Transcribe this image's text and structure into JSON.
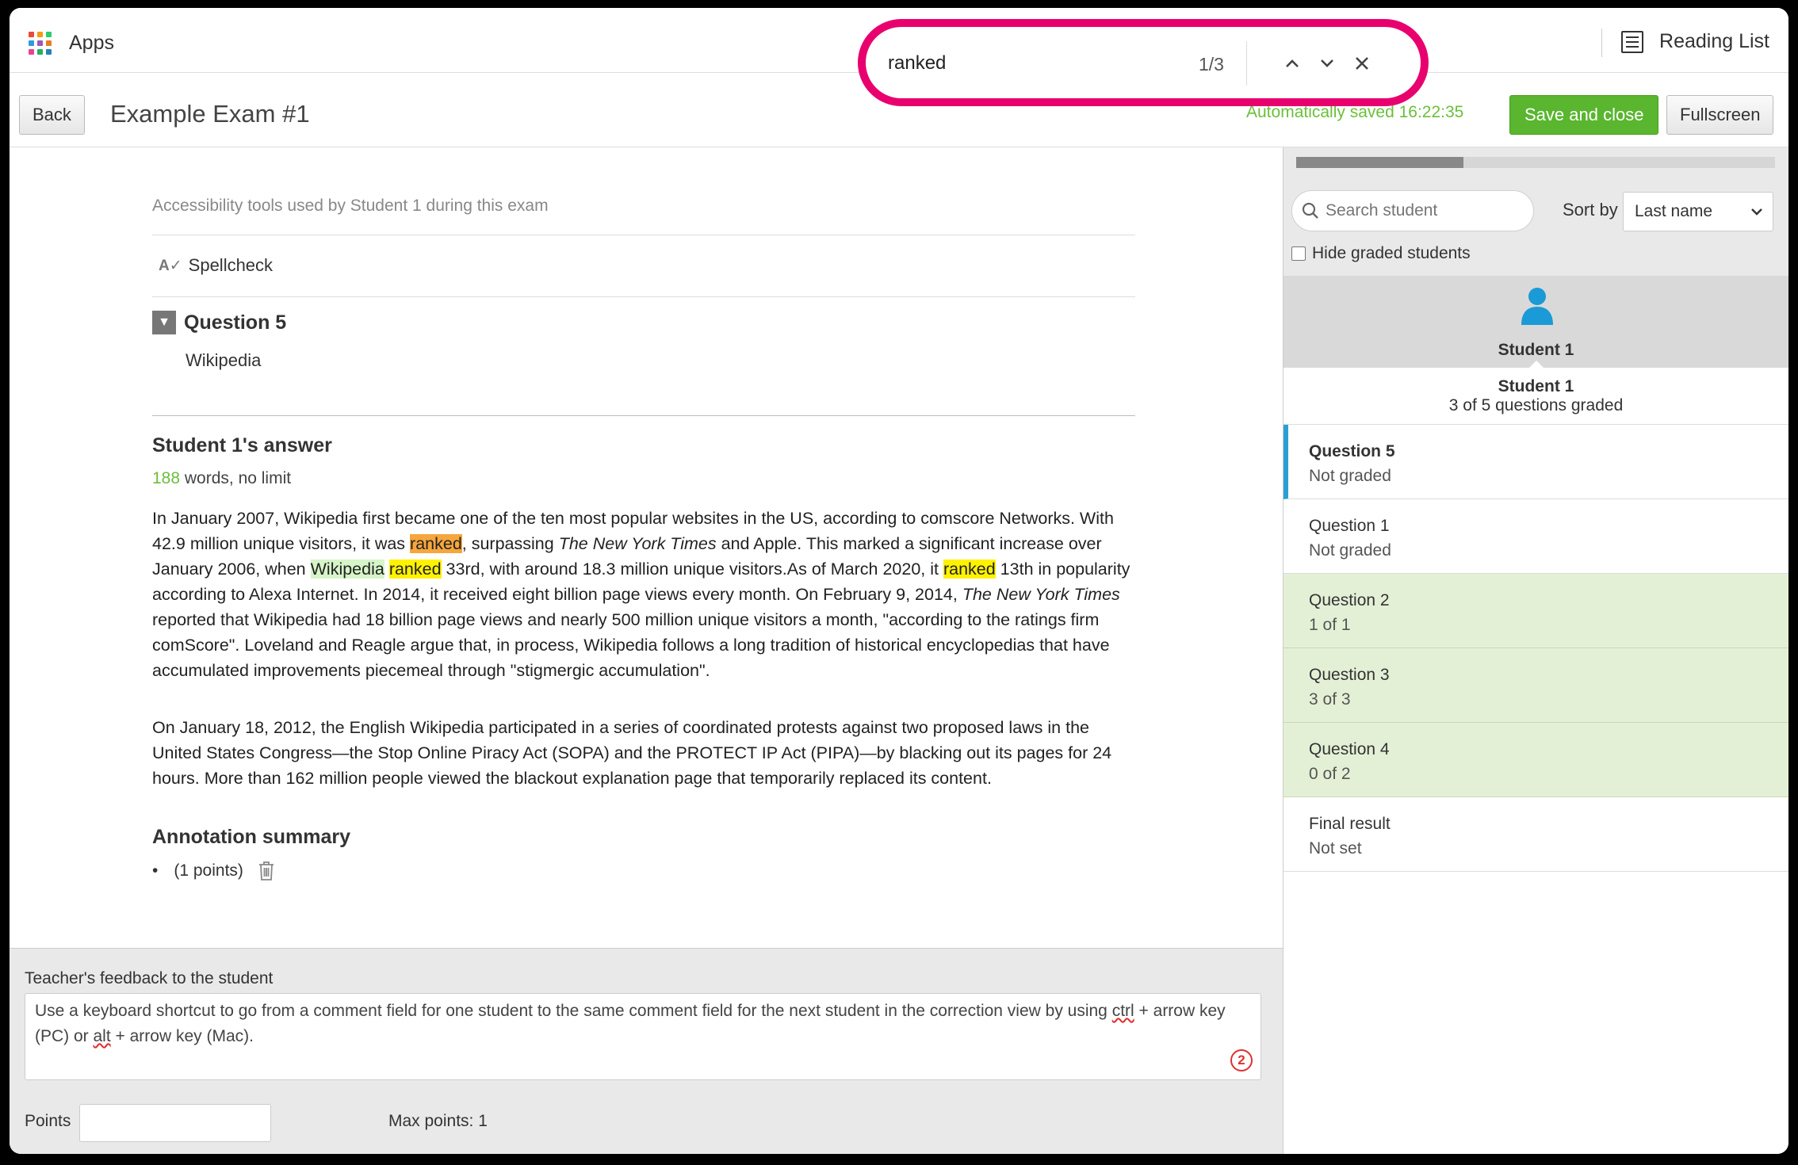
{
  "topbar": {
    "apps_label": "Apps",
    "reading_list_label": "Reading List",
    "app_grid_colors": [
      "#e74c3c",
      "#f39c12",
      "#2ecc71",
      "#3498db",
      "#9b59b6",
      "#e67e22",
      "#e84393",
      "#27ae60",
      "#2980b9"
    ]
  },
  "find": {
    "query": "ranked",
    "count": "1/3"
  },
  "header": {
    "back_label": "Back",
    "title": "Example Exam #1",
    "autosave": "Automatically saved 16:22:35",
    "save_label": "Save and close",
    "fullscreen_label": "Fullscreen"
  },
  "exam": {
    "accessibility_label": "Accessibility tools used by Student 1 during this exam",
    "spellcheck_icon": "A✓",
    "spellcheck_label": "Spellcheck",
    "question_title": "Question 5",
    "question_subtitle": "Wikipedia",
    "answer_title": "Student 1's answer",
    "word_count": "188",
    "word_count_suffix": " words, no limit",
    "p1": {
      "a": "In January 2007, Wikipedia first became one of the ten most popular websites in the US, according to comscore Networks. With 42.9 million unique visitors, it was ",
      "h1": "ranked",
      "b": ", surpassing ",
      "i1": "The New York Times",
      "c": " and Apple. This marked a significant increase over January 2006, when ",
      "h2": "Wikipedia",
      "d": " ",
      "h3": "ranked",
      "e": " 33rd, with around 18.3 million unique visitors.As of March 2020, it ",
      "h4": "ranked",
      "f": " 13th in popularity according to Alexa Internet. In 2014, it received eight billion page views every month. On February 9, 2014, ",
      "i2": "The New York Times",
      "g": " reported that Wikipedia had 18 billion page views and nearly 500 million unique visitors a month, \"according to the ratings firm comScore\". Loveland and Reagle argue that, in process, Wikipedia follows a long tradition of historical encyclopedias that have accumulated improvements piecemeal through \"stigmergic accumulation\"."
    },
    "p2": "On January 18, 2012, the English Wikipedia participated in a series of coordinated protests against two proposed laws in the United States Congress—the Stop Online Piracy Act (SOPA) and the PROTECT IP Act (PIPA)—by blacking out its pages for 24 hours. More than 162 million people viewed the blackout explanation page that temporarily replaced its content.",
    "annotation_title": "Annotation summary",
    "annotation_item": "(1 points)"
  },
  "feedback": {
    "label": "Teacher's feedback to the student",
    "text_a": "Use a keyboard shortcut to go from a comment field for one student to the same comment field for the next student in the correction view by using ",
    "ctrl": "ctrl",
    "text_b": " + arrow key (PC) or ",
    "alt": "alt",
    "text_c": " + arrow key (Mac).",
    "issue_count": "2",
    "points_label": "Points",
    "points_value": "",
    "max_points": "Max points: 1"
  },
  "panel": {
    "progress": 0.35,
    "search_placeholder": "Search student",
    "sort_label": "Sort by",
    "sort_value": "Last name",
    "hide_graded_label": "Hide graded students",
    "student_card_name": "Student 1",
    "student_name": "Student 1",
    "graded_summary": "3 of 5 questions graded",
    "questions": [
      {
        "title": "Question 5",
        "status": "Not graded"
      },
      {
        "title": "Question 1",
        "status": "Not graded"
      },
      {
        "title": "Question 2",
        "status": "1 of 1"
      },
      {
        "title": "Question 3",
        "status": "3 of 3"
      },
      {
        "title": "Question 4",
        "status": "0 of 2"
      },
      {
        "title": "Final result",
        "status": "Not set"
      }
    ]
  }
}
